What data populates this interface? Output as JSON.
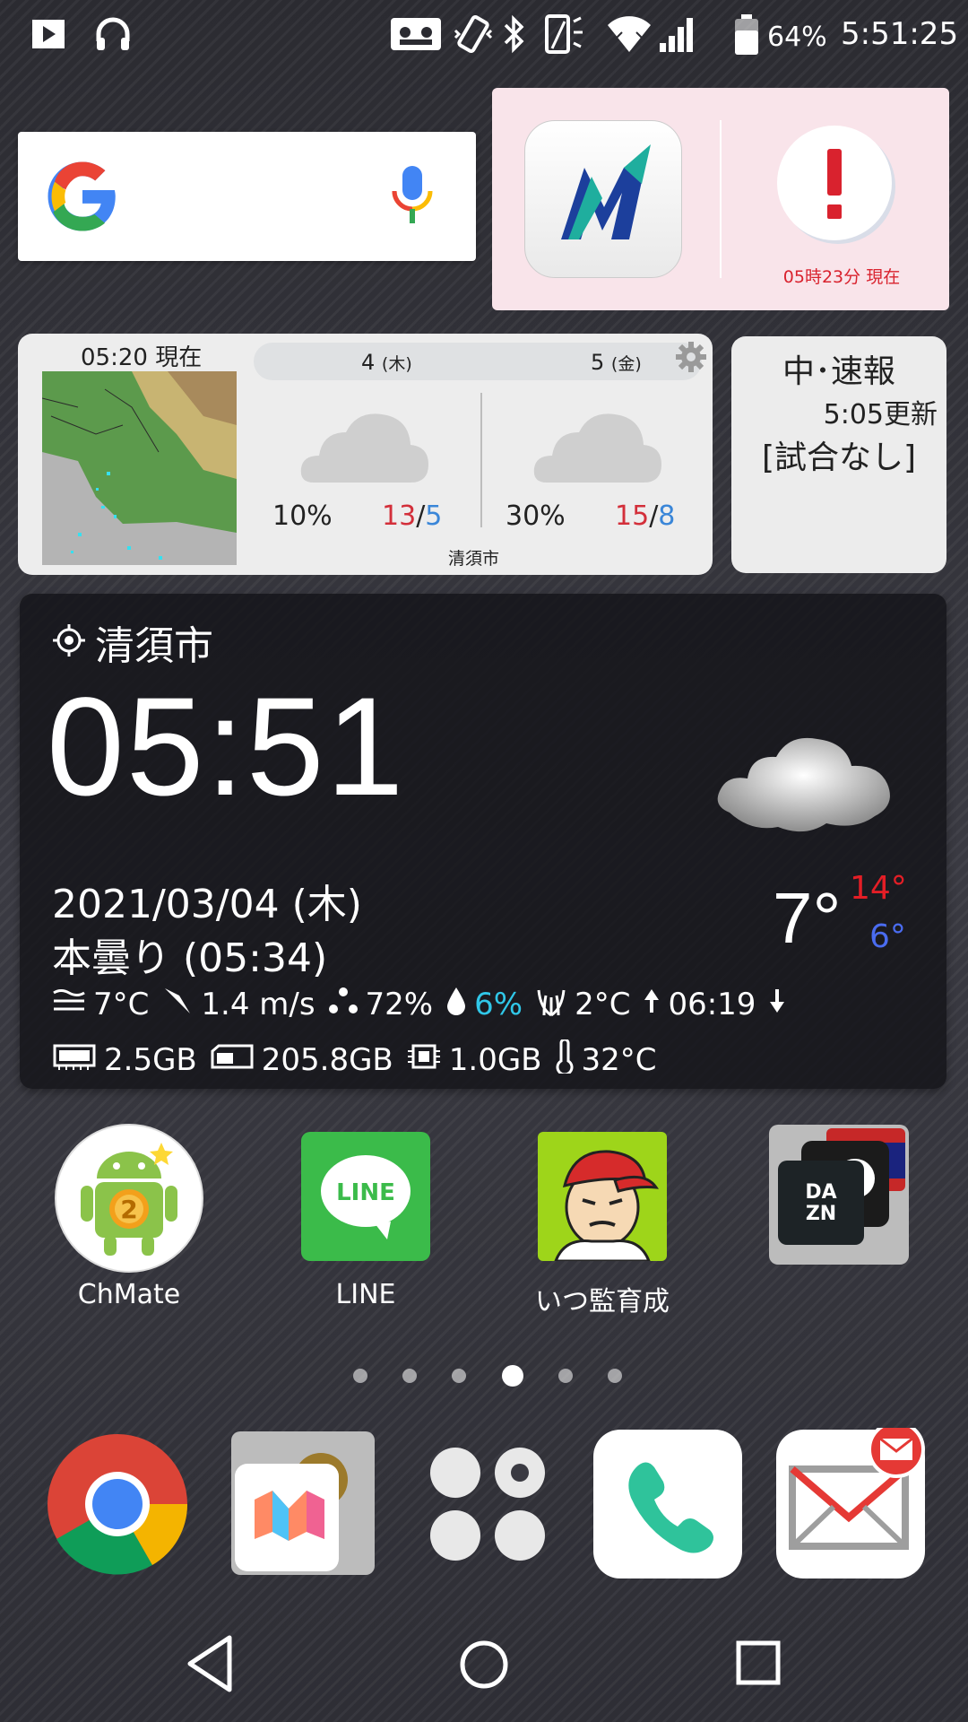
{
  "status_bar": {
    "battery_percent": "64%",
    "time": "5:51:25",
    "icons": [
      "play-icon",
      "headphones-icon",
      "voicemail-icon",
      "vibrate-icon",
      "bluetooth-icon",
      "battery-saver-icon",
      "wifi-icon",
      "signal-icon",
      "battery-icon"
    ]
  },
  "google_search": {
    "icons": [
      "google-g-icon",
      "microphone-icon"
    ]
  },
  "alert_widget": {
    "time_text": "05時23分 現在",
    "colors": {
      "background": "#f9e4ea",
      "accent": "#d9222e"
    }
  },
  "forecast_widget": {
    "radar_time": "05:20 現在",
    "days": [
      {
        "day": "4",
        "weekday": "(木)",
        "precip": "10%",
        "high": "13",
        "low": "5"
      },
      {
        "day": "5",
        "weekday": "(金)",
        "precip": "30%",
        "high": "15",
        "low": "8"
      }
    ],
    "separator": "/",
    "city": "清須市"
  },
  "baseball_widget": {
    "title": "中･速報",
    "update": "5:05更新",
    "status": "[試合なし]"
  },
  "clock_widget": {
    "location": "清須市",
    "time": "05:51",
    "date": "2021/03/04 (木)",
    "condition": "本曇り (05:34)",
    "temp": "7°",
    "high": "14°",
    "low": "6°",
    "stats1": {
      "feels": "7°C",
      "wind": "1.4 m/s",
      "humidity": "72%",
      "precip": "6%",
      "dew": "2°C",
      "sunrise": "06:19"
    },
    "stats2": {
      "ram": "2.5GB",
      "storage": "205.8GB",
      "cpu": "1.0GB",
      "battery_temp": "32°C"
    }
  },
  "apps": [
    {
      "label": "ChMate"
    },
    {
      "label": "LINE"
    },
    {
      "label": "いつ監育成"
    },
    {
      "label": ""
    }
  ],
  "folder_dazn_text": "DA\nZN",
  "line_icon_text": "LINE",
  "page_dots": {
    "count": 6,
    "active_index": 3
  },
  "dock": [
    "chrome-icon",
    "maps-folder-icon",
    "app-drawer-icon",
    "phone-icon",
    "mail-icon"
  ],
  "nav": [
    "back-button",
    "home-button",
    "recents-button"
  ]
}
